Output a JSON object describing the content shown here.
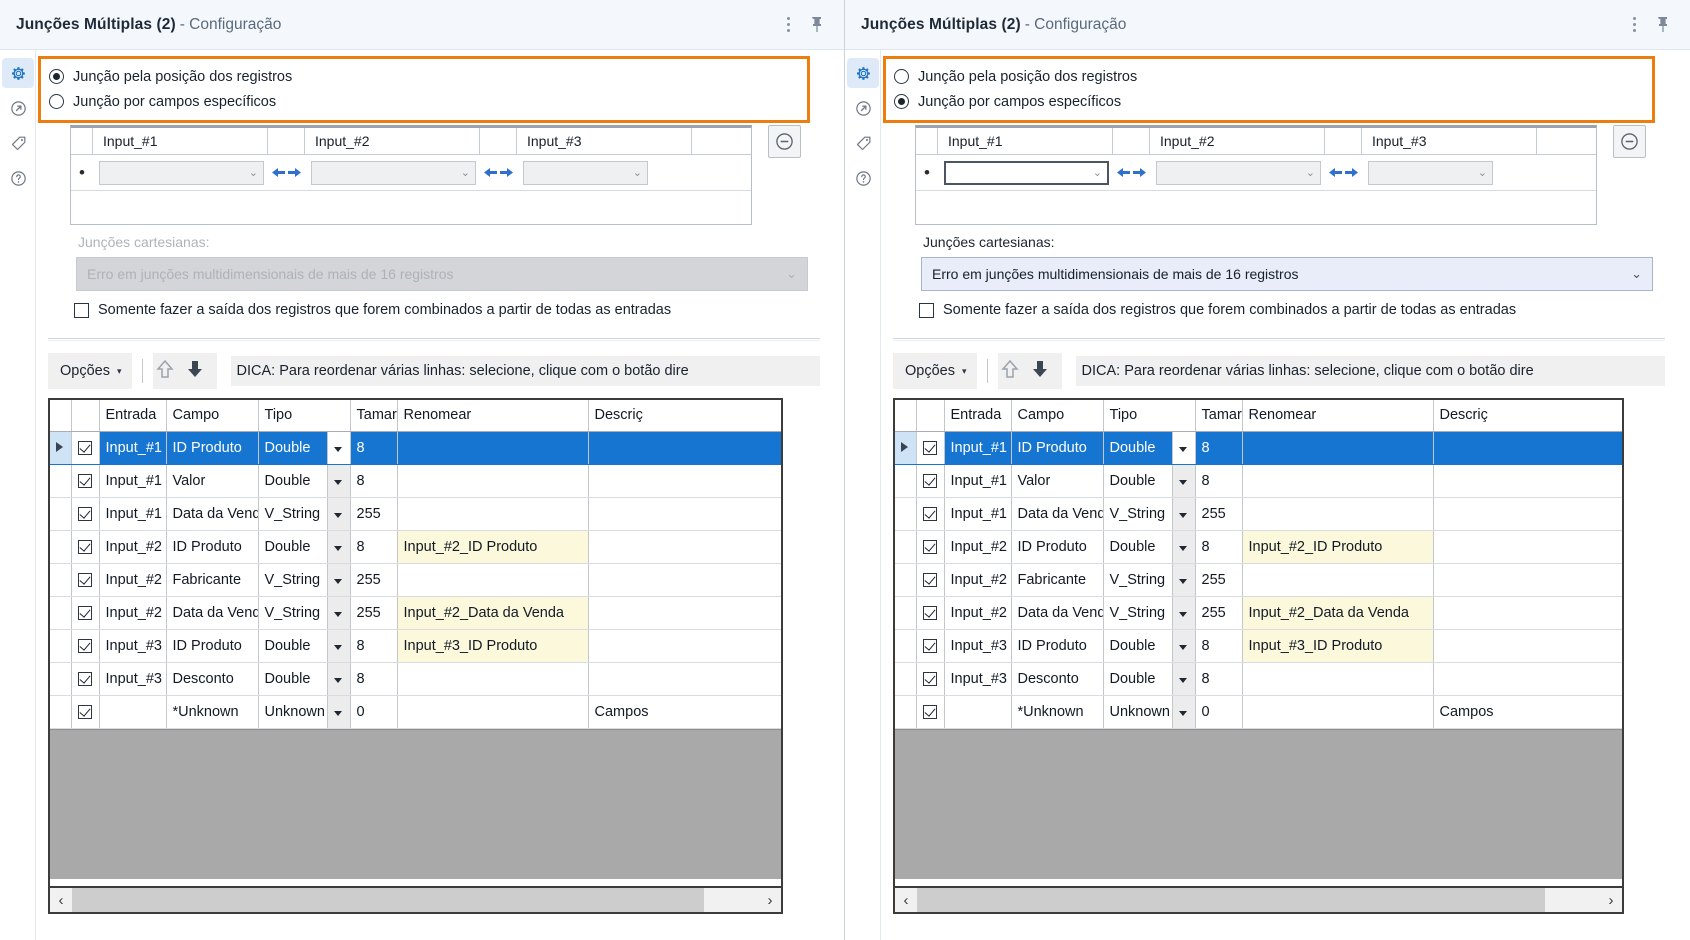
{
  "window": {
    "title": "Junções Múltiplas (2)",
    "subtitle": "- Configuração",
    "menu_icon": "kebab-menu-icon",
    "pin_icon": "pin-icon"
  },
  "rail": {
    "items": [
      {
        "icon": "gear-icon",
        "active": true
      },
      {
        "icon": "arrow-circle-icon",
        "active": false
      },
      {
        "icon": "tag-icon",
        "active": false
      },
      {
        "icon": "help-circle-icon",
        "active": false
      }
    ]
  },
  "colors": {
    "highlight_border": "#ee7d10",
    "selection_blue": "#1675d1",
    "renamed_yellow": "#fcf8dc",
    "rail_active": "#dfeaf9"
  },
  "radios": {
    "by_position": "Junção pela posição dos registros",
    "by_fields": "Junção por campos específicos"
  },
  "join_grid": {
    "headers": [
      "Input_#1",
      "Input_#2",
      "Input_#3"
    ],
    "row_bullet": "•",
    "combo_value": "",
    "chevron": "⌄",
    "remove_button": "⊖",
    "left_arrow_icon": "arrow-left-icon",
    "right_arrow_icon": "arrow-right-icon"
  },
  "cartesian": {
    "label": "Junções cartesianas:",
    "selected": "Erro em junções multidimensionais de mais de 16 registros",
    "chevron": "⌄"
  },
  "checkbox_option": {
    "label": "Somente fazer a saída dos registros que forem combinados a partir de todas as entradas",
    "checked": false
  },
  "toolbar": {
    "options_label": "Opções",
    "caret": "▾",
    "up_icon": "arrow-up-icon",
    "down_icon": "arrow-down-icon",
    "tip": "DICA: Para reordenar várias linhas: selecione, clique com o botão dire"
  },
  "table": {
    "headers": [
      "",
      "",
      "Entrada",
      "Campo",
      "Tipo",
      "",
      "Tamar",
      "Renomear",
      "Descriç"
    ],
    "rows": [
      {
        "selected": true,
        "checked": true,
        "entrada": "Input_#1",
        "campo": "ID Produto",
        "tipo": "Double",
        "tamanho": "8",
        "renomear": "",
        "descricao": "",
        "tipo_dim": false,
        "tam_dim": false
      },
      {
        "selected": false,
        "checked": true,
        "entrada": "Input_#1",
        "campo": "Valor",
        "tipo": "Double",
        "tamanho": "8",
        "renomear": "",
        "descricao": "",
        "tipo_dim": false,
        "tam_dim": true
      },
      {
        "selected": false,
        "checked": true,
        "entrada": "Input_#1",
        "campo": "Data da Venda",
        "tipo": "V_String",
        "tamanho": "255",
        "renomear": "",
        "descricao": "",
        "tipo_dim": false,
        "tam_dim": false
      },
      {
        "selected": false,
        "checked": true,
        "entrada": "Input_#2",
        "campo": "ID Produto",
        "tipo": "Double",
        "tamanho": "8",
        "renomear": "Input_#2_ID Produto",
        "descricao": "",
        "tipo_dim": false,
        "tam_dim": true
      },
      {
        "selected": false,
        "checked": true,
        "entrada": "Input_#2",
        "campo": "Fabricante",
        "tipo": "V_String",
        "tamanho": "255",
        "renomear": "",
        "descricao": "",
        "tipo_dim": false,
        "tam_dim": false
      },
      {
        "selected": false,
        "checked": true,
        "entrada": "Input_#2",
        "campo": "Data da Venda",
        "tipo": "V_String",
        "tamanho": "255",
        "renomear": "Input_#2_Data da Venda",
        "descricao": "",
        "tipo_dim": false,
        "tam_dim": false
      },
      {
        "selected": false,
        "checked": true,
        "entrada": "Input_#3",
        "campo": "ID Produto",
        "tipo": "Double",
        "tamanho": "8",
        "renomear": "Input_#3_ID Produto",
        "descricao": "",
        "tipo_dim": false,
        "tam_dim": true
      },
      {
        "selected": false,
        "checked": true,
        "entrada": "Input_#3",
        "campo": "Desconto",
        "tipo": "Double",
        "tamanho": "8",
        "renomear": "",
        "descricao": "",
        "tipo_dim": false,
        "tam_dim": true
      },
      {
        "selected": false,
        "checked": true,
        "entrada": "",
        "campo": "*Unknown",
        "tipo": "Unknown",
        "tamanho": "0",
        "renomear": "",
        "descricao": "Campos",
        "tipo_dim": true,
        "tam_dim": true
      }
    ]
  },
  "scrollbar": {
    "left_arrow": "‹",
    "right_arrow": "›"
  },
  "panels": {
    "left": {
      "by_position_selected": true,
      "by_fields_selected": false,
      "cartesian_enabled": false,
      "combo1_focused": false
    },
    "right": {
      "by_position_selected": false,
      "by_fields_selected": true,
      "cartesian_enabled": true,
      "combo1_focused": true
    }
  }
}
